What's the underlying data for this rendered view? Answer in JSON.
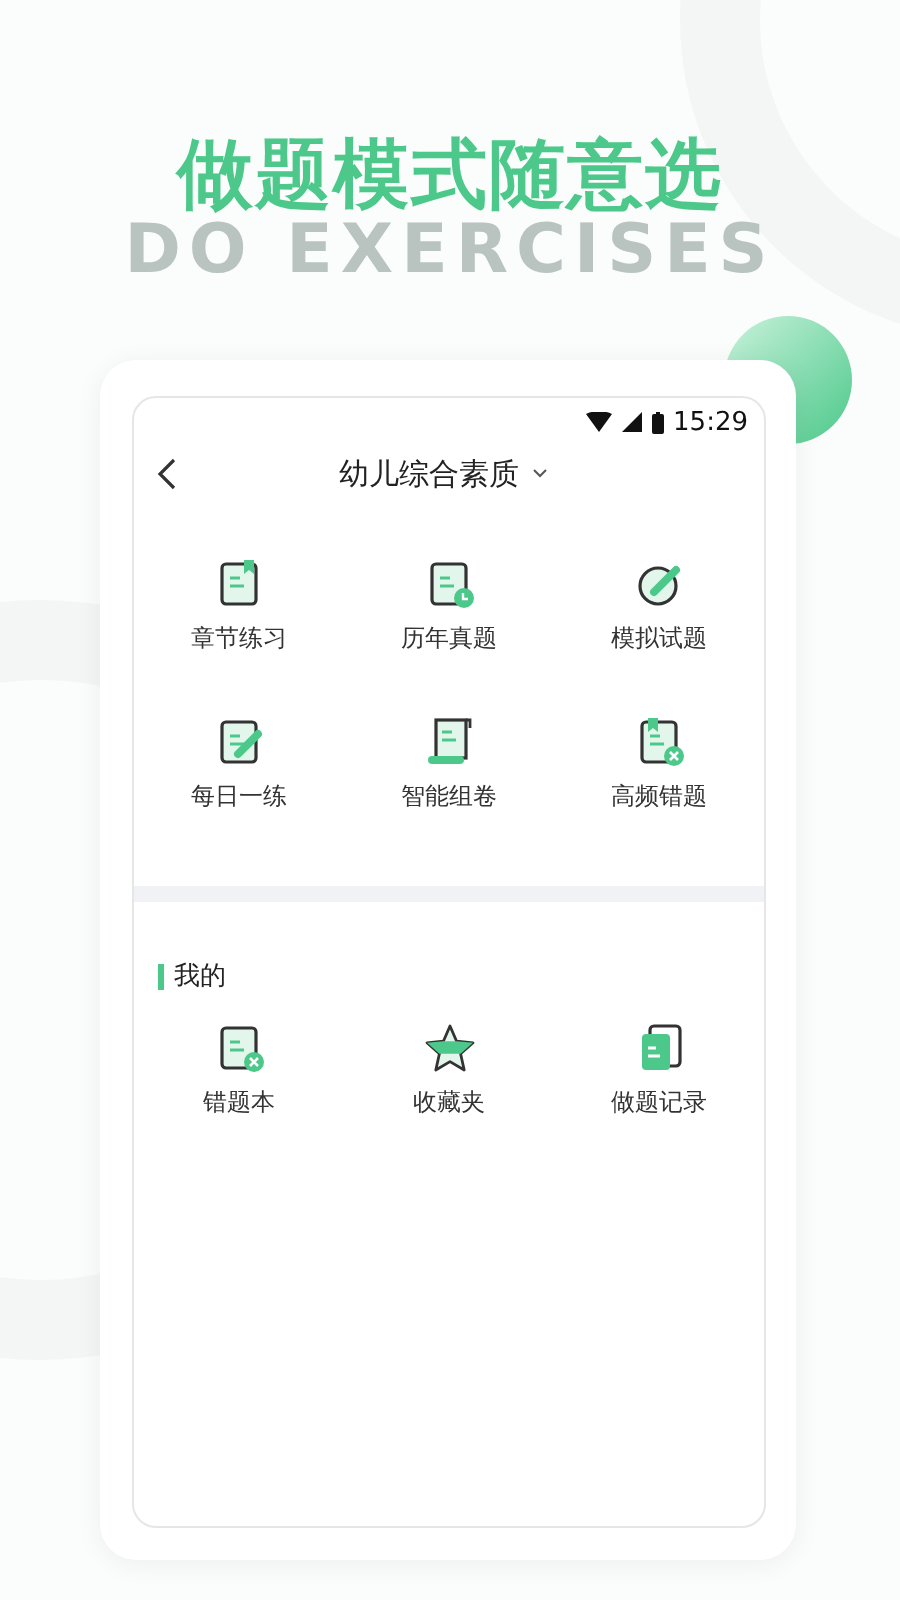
{
  "headline": "做题模式随意选",
  "headline_backdrop": "DO EXERCISES",
  "status_bar": {
    "time": "15:29"
  },
  "header": {
    "title": "幼儿综合素质"
  },
  "modes": [
    {
      "label": "章节练习"
    },
    {
      "label": "历年真题"
    },
    {
      "label": "模拟试题"
    },
    {
      "label": "每日一练"
    },
    {
      "label": "智能组卷"
    },
    {
      "label": "高频错题"
    }
  ],
  "mine": {
    "title": "我的",
    "items": [
      {
        "label": "错题本"
      },
      {
        "label": "收藏夹"
      },
      {
        "label": "做题记录"
      }
    ]
  }
}
